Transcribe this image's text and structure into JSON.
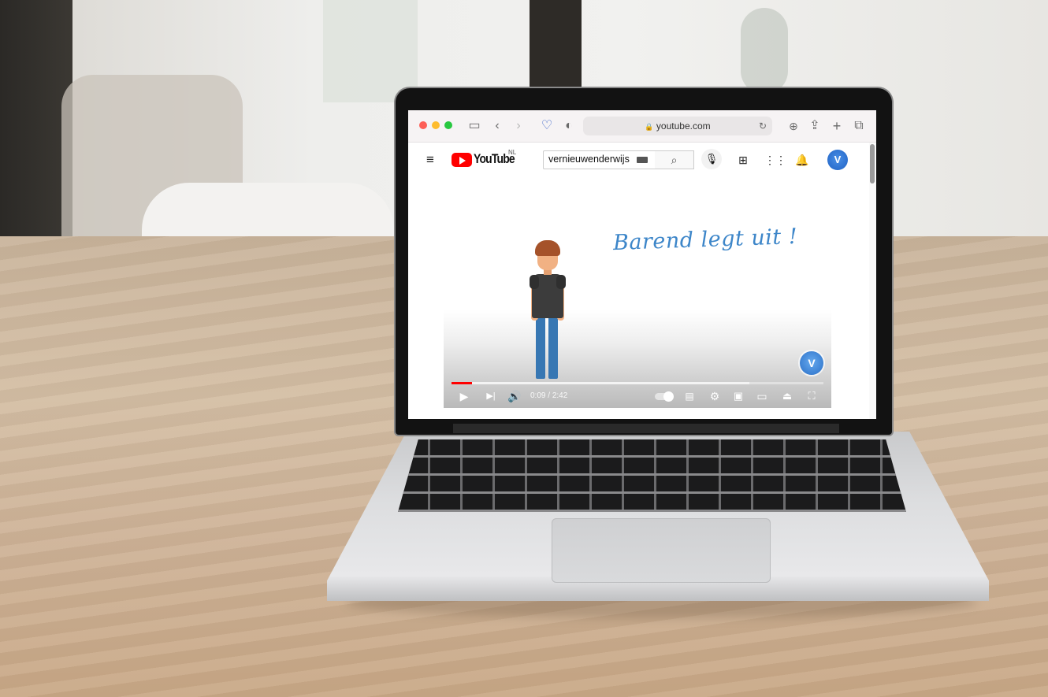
{
  "browser": {
    "url": "youtube.com",
    "toolbar_icons": [
      "sidebar-icon",
      "back-icon",
      "forward-icon",
      "pocket-icon",
      "shield-icon",
      "reload-icon",
      "download-icon",
      "share-icon",
      "new-tab-icon",
      "tabs-icon"
    ]
  },
  "youtube": {
    "logo_text": "YouTube",
    "country_code": "NL",
    "search_value": "vernieuwenderwijs",
    "avatar_initial": "V",
    "accent_color": "#ff0000"
  },
  "video": {
    "title_overlay": "Barend legt uit !",
    "current_time": "0:09",
    "duration": "2:42",
    "time_separator": " / ",
    "played_fraction": 0.056,
    "buffered_fraction": 0.8,
    "badge_initial": "V",
    "title_color": "#3d86c9"
  }
}
